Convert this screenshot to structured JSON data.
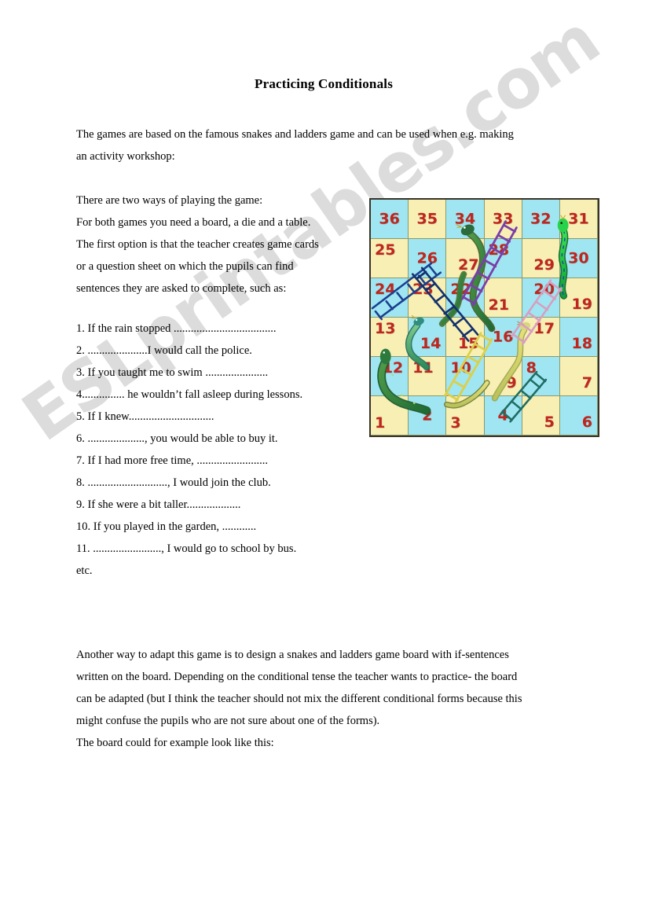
{
  "document": {
    "title": "Practicing Conditionals",
    "intro": [
      "The games are based on the famous snakes and ladders game and can be used when e.g. making",
      "an activity workshop:"
    ],
    "ways": [
      "There are two ways of playing the game:",
      "For both games you need a board, a die and a table.",
      "The first option is that the teacher creates game cards",
      "or a question sheet on which the pupils can find",
      "sentences they are asked to complete, such as:"
    ],
    "exercises": [
      "1. If the rain stopped ....................................",
      "2. .....................I would call the police.",
      "3. If you taught me to swim ......................",
      "4............... he wouldn’t fall asleep during lessons.",
      "5. If I knew..............................",
      "6. ...................., you would be able to buy it.",
      "7. If I had more free time, .........................",
      "8. ............................, I would join the club.",
      "9. If she were a bit taller...................",
      "10. If you played in the garden, ............",
      "11. ........................, I would go to school by bus.",
      "etc."
    ],
    "closing": [
      "Another way to adapt this game is to design a snakes and ladders game board with if-sentences",
      "written on the board. Depending on the conditional tense the teacher wants to practice- the board",
      "can be adapted (but I think the teacher should not mix the different conditional forms because this",
      "might confuse the pupils who are not sure about one of the forms).",
      "The board could for example look like this:"
    ]
  },
  "watermark": {
    "text": "ESLprintables.com"
  },
  "board": {
    "rows": 6,
    "columns": 6,
    "colors": {
      "yellow": "#f7efb4",
      "cyan": "#9fe6f2",
      "number": "#c0261d",
      "gridline": "#8a9a6a",
      "border": "#3a3326"
    },
    "cells": [
      {
        "n": "36",
        "fill": "cyan",
        "pos": "p-c"
      },
      {
        "n": "35",
        "fill": "yellow",
        "pos": "p-c"
      },
      {
        "n": "34",
        "fill": "cyan",
        "pos": "p-c"
      },
      {
        "n": "33",
        "fill": "yellow",
        "pos": "p-c"
      },
      {
        "n": "32",
        "fill": "cyan",
        "pos": "p-c"
      },
      {
        "n": "31",
        "fill": "yellow",
        "pos": "p-c"
      },
      {
        "n": "25",
        "fill": "yellow",
        "pos": "p-tl"
      },
      {
        "n": "26",
        "fill": "cyan",
        "pos": "p-c"
      },
      {
        "n": "27",
        "fill": "yellow",
        "pos": "p-br"
      },
      {
        "n": "28",
        "fill": "cyan",
        "pos": "p-tl"
      },
      {
        "n": "29",
        "fill": "yellow",
        "pos": "p-br"
      },
      {
        "n": "30",
        "fill": "cyan",
        "pos": "p-c"
      },
      {
        "n": "24",
        "fill": "cyan",
        "pos": "p-tl"
      },
      {
        "n": "23",
        "fill": "yellow",
        "pos": "p-tl"
      },
      {
        "n": "22",
        "fill": "cyan",
        "pos": "p-tl"
      },
      {
        "n": "21",
        "fill": "yellow",
        "pos": "p-bl"
      },
      {
        "n": "20",
        "fill": "cyan",
        "pos": "p-tr"
      },
      {
        "n": "19",
        "fill": "yellow",
        "pos": "p-br"
      },
      {
        "n": "13",
        "fill": "yellow",
        "pos": "p-tl"
      },
      {
        "n": "14",
        "fill": "cyan",
        "pos": "p-br"
      },
      {
        "n": "15",
        "fill": "yellow",
        "pos": "p-br"
      },
      {
        "n": "16",
        "fill": "cyan",
        "pos": "p-c"
      },
      {
        "n": "17",
        "fill": "yellow",
        "pos": "p-tr"
      },
      {
        "n": "18",
        "fill": "cyan",
        "pos": "p-br"
      },
      {
        "n": "12",
        "fill": "cyan",
        "pos": "p-tr"
      },
      {
        "n": "11",
        "fill": "yellow",
        "pos": "p-tl"
      },
      {
        "n": "10",
        "fill": "cyan",
        "pos": "p-tl"
      },
      {
        "n": "9",
        "fill": "yellow",
        "pos": "p-br"
      },
      {
        "n": "8",
        "fill": "cyan",
        "pos": "p-tl"
      },
      {
        "n": "7",
        "fill": "yellow",
        "pos": "p-br"
      },
      {
        "n": "1",
        "fill": "yellow",
        "pos": "p-bl"
      },
      {
        "n": "2",
        "fill": "cyan",
        "pos": "p-c"
      },
      {
        "n": "3",
        "fill": "yellow",
        "pos": "p-bl"
      },
      {
        "n": "4",
        "fill": "cyan",
        "pos": "p-c"
      },
      {
        "n": "5",
        "fill": "yellow",
        "pos": "p-br"
      },
      {
        "n": "6",
        "fill": "cyan",
        "pos": "p-br"
      }
    ]
  }
}
